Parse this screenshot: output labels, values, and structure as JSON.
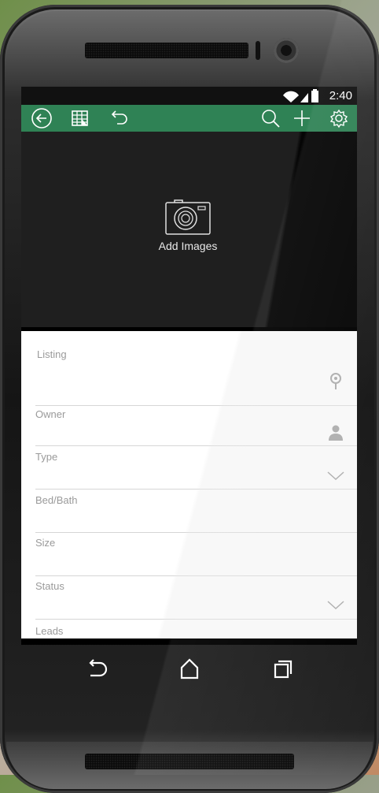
{
  "statusbar": {
    "time": "2:40"
  },
  "toolbar": {
    "icons": [
      "back-circle-icon",
      "spreadsheet-icon",
      "undo-icon",
      "search-icon",
      "add-icon",
      "settings-icon"
    ]
  },
  "photo": {
    "add_images_label": "Add Images"
  },
  "form": {
    "fields": [
      {
        "label": "Listing",
        "icon": "map-pin-icon"
      },
      {
        "label": "Owner",
        "icon": "person-icon"
      },
      {
        "label": "Type",
        "icon": "chevron-down-icon"
      },
      {
        "label": "Bed/Bath"
      },
      {
        "label": "Size"
      },
      {
        "label": "Status",
        "icon": "chevron-down-icon"
      },
      {
        "label": "Leads"
      }
    ]
  },
  "navbar": {
    "icons": [
      "back-icon",
      "home-icon",
      "recent-apps-icon"
    ]
  },
  "colors": {
    "toolbar": "#2f8255",
    "photo_bg": "#1f1f1f",
    "label": "#9a9a9a"
  }
}
